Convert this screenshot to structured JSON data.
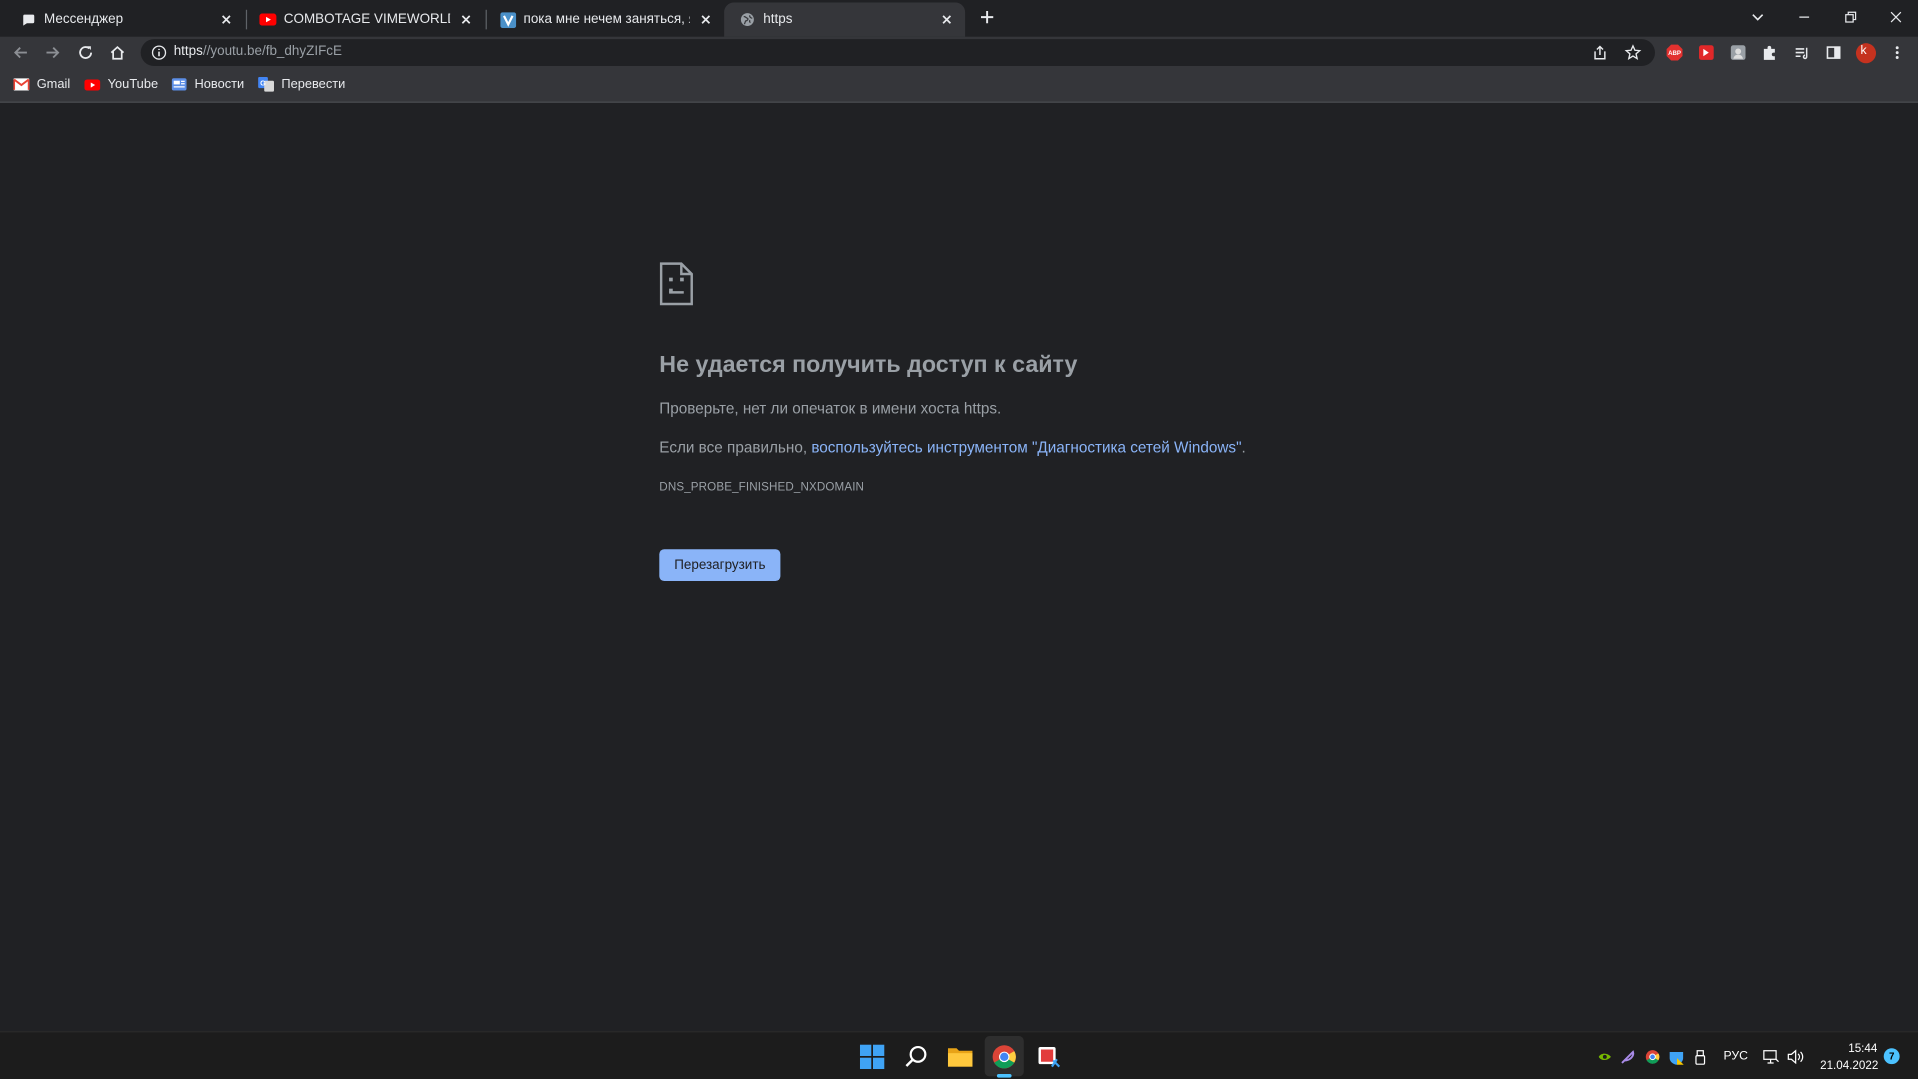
{
  "browser": {
    "tabs": [
      {
        "title": "Мессенджер",
        "icon": "messenger-icon",
        "active": false
      },
      {
        "title": "COMBOTAGE VIMEWORLD | RAP",
        "icon": "youtube-icon",
        "active": false
      },
      {
        "title": "пока мне нечем заняться, я буду",
        "icon": "tumblr-ish-icon",
        "active": false
      },
      {
        "title": "https",
        "icon": "globe-icon",
        "active": true
      }
    ],
    "omnibox": {
      "scheme": "https",
      "rest": "//youtu.be/fb_dhyZIFcE"
    },
    "bookmarks": [
      {
        "label": "Gmail",
        "icon": "gmail-icon"
      },
      {
        "label": "YouTube",
        "icon": "youtube-icon"
      },
      {
        "label": "Новости",
        "icon": "news-icon"
      },
      {
        "label": "Перевести",
        "icon": "translate-icon"
      }
    ],
    "profile_initial": "k",
    "extensions": [
      "adblock-icon",
      "red-extension-icon",
      "gray-extension-icon",
      "puzzle-icon",
      "reading-list-icon",
      "side-panel-icon"
    ]
  },
  "error": {
    "title": "Не удается получить доступ к сайту",
    "hint": "Проверьте, нет ли опечаток в имени хоста https.",
    "line2_prefix": "Если все правильно, ",
    "line2_link": "воспользуйтесь инструментом \"Диагностика сетей Windows\"",
    "line2_suffix": ".",
    "code": "DNS_PROBE_FINISHED_NXDOMAIN",
    "reload_label": "Перезагрузить"
  },
  "taskbar": {
    "apps": [
      "windows-start-icon",
      "search-icon",
      "file-explorer-icon",
      "chrome-icon",
      "snipping-tool-icon"
    ],
    "language": "РУС",
    "time": "15:44",
    "date": "21.04.2022",
    "notifications": "7"
  },
  "colors": {
    "accent": "#8ab4f8",
    "background": "#202124",
    "toolbar": "#35363a"
  }
}
